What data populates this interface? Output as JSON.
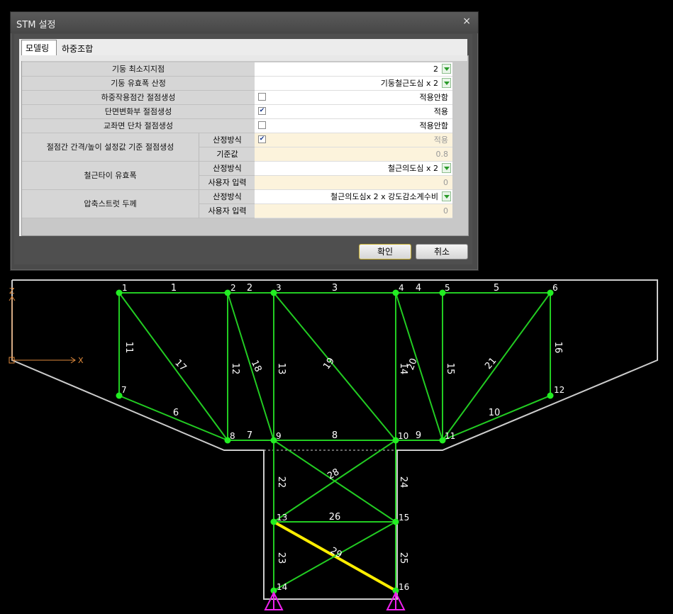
{
  "dialog": {
    "title": "STM 설정",
    "close_glyph": "×",
    "tabs": [
      {
        "label": "모델링"
      },
      {
        "label": "하중조합"
      }
    ],
    "ok_label": "확인",
    "cancel_label": "취소",
    "rows": [
      {
        "label": "기둥 최소지지점",
        "value": "2",
        "dropdown": true
      },
      {
        "label": "기둥 유효폭 산정",
        "value": "기둥철근도심 x 2",
        "dropdown": true
      },
      {
        "label": "하중작용점간 절점생성",
        "checked": false,
        "value": "적용안함"
      },
      {
        "label": "단면변화부 절점생성",
        "checked": true,
        "value": "적용"
      },
      {
        "label": "교좌면 단차 절점생성",
        "checked": false,
        "value": "적용안함"
      }
    ],
    "groups": [
      {
        "label": "절점간 간격/높이 설정값 기준 절점생성",
        "sub": [
          {
            "label": "산정방식",
            "checked": true,
            "value": "적용"
          },
          {
            "label": "기준값",
            "value": "0.8"
          }
        ]
      },
      {
        "label": "철근타이 유효폭",
        "sub": [
          {
            "label": "산정방식",
            "value": "철근의도심 x 2",
            "dropdown": true
          },
          {
            "label": "사용자 입력",
            "value": "0"
          }
        ]
      },
      {
        "label": "압축스트럿 두께",
        "sub": [
          {
            "label": "산정방식",
            "value": "철근의도심x 2 x 강도감소계수비",
            "dropdown": true
          },
          {
            "label": "사용자 입력",
            "value": "0"
          }
        ]
      }
    ]
  },
  "model": {
    "axis_labels": {
      "z": "Z",
      "x": "X"
    },
    "colors": {
      "member": "#22cc22",
      "highlight": "#ffee00",
      "outline": "#cccccc",
      "support": "#ee22ee",
      "axis": "#e08a3c",
      "node": "#22ee22"
    },
    "node_labels": [
      "1",
      "2",
      "3",
      "4",
      "5",
      "6",
      "7",
      "8",
      "9",
      "10",
      "11",
      "12",
      "13",
      "14",
      "15",
      "16"
    ],
    "member_labels": [
      "1",
      "2",
      "3",
      "4",
      "5",
      "6",
      "7",
      "8",
      "9",
      "10",
      "11",
      "12",
      "13",
      "14",
      "15",
      "16",
      "17",
      "18",
      "19",
      "20",
      "21",
      "22",
      "23",
      "24",
      "25",
      "26"
    ],
    "cross_labels": [
      "28",
      "29"
    ]
  }
}
